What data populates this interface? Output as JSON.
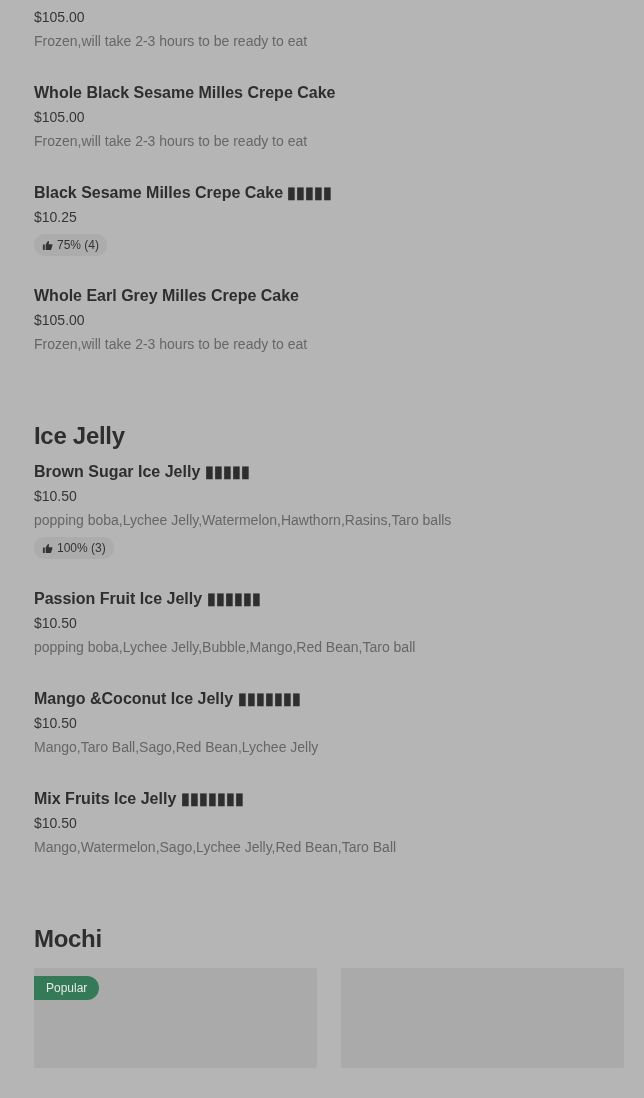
{
  "sections": [
    {
      "items": [
        {
          "price": "$105.00",
          "description": "Frozen,will take 2-3 hours to be ready to eat"
        },
        {
          "name": "Whole Black Sesame Milles Crepe Cake",
          "price": "$105.00",
          "description": "Frozen,will take 2-3 hours to be ready to eat"
        },
        {
          "name": "Black Sesame Milles Crepe Cake ▮▮▮▮▮",
          "price": "$10.25",
          "rating": "75% (4)"
        },
        {
          "name": "Whole Earl Grey Milles Crepe Cake",
          "price": "$105.00",
          "description": "Frozen,will take 2-3 hours to be ready to eat"
        }
      ]
    },
    {
      "heading": "Ice Jelly",
      "items": [
        {
          "name": "Brown Sugar Ice Jelly ▮▮▮▮▮",
          "price": "$10.50",
          "description": "popping boba,Lychee Jelly,Watermelon,Hawthorn,Rasins,Taro balls",
          "rating": "100% (3)"
        },
        {
          "name": "Passion Fruit Ice Jelly ▮▮▮▮▮▮",
          "price": "$10.50",
          "description": "popping boba,Lychee Jelly,Bubble,Mango,Red Bean,Taro ball"
        },
        {
          "name": "Mango &Coconut Ice Jelly ▮▮▮▮▮▮▮",
          "price": "$10.50",
          "description": "Mango,Taro Ball,Sago,Red Bean,Lychee Jelly"
        },
        {
          "name": "Mix Fruits Ice Jelly ▮▮▮▮▮▮▮",
          "price": "$10.50",
          "description": "Mango,Watermelon,Sago,Lychee Jelly,Red Bean,Taro Ball"
        }
      ]
    },
    {
      "heading": "Mochi",
      "cards": [
        {
          "kind": "card",
          "badge": "Popular"
        },
        {
          "kind": "card"
        }
      ]
    }
  ]
}
